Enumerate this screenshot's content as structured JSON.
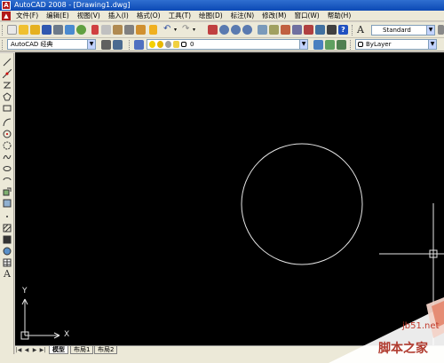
{
  "window": {
    "title": "AutoCAD 2008 - [Drawing1.dwg]",
    "logo_letter": "A"
  },
  "menu": {
    "items": [
      "文件(F)",
      "编辑(E)",
      "视图(V)",
      "插入(I)",
      "格式(O)",
      "工具(T)",
      "绘图(D)",
      "标注(N)",
      "修改(M)",
      "窗口(W)",
      "帮助(H)"
    ]
  },
  "toolbar": {
    "workspace": "AutoCAD 经典",
    "layer_value": "0",
    "text_style": "Standard",
    "color_value": "ByLayer",
    "text_style_icon_glyph": "A"
  },
  "left_toolbar": {
    "text_tool_glyph": "A"
  },
  "canvas": {
    "background": "#000000",
    "ucs_y_label": "Y",
    "ucs_x_label": "X"
  },
  "layout_tabs": {
    "tabs": [
      "模型",
      "布局1",
      "布局2"
    ]
  },
  "watermark": {
    "url": "jb51.net",
    "site_name": "脚本之家"
  }
}
